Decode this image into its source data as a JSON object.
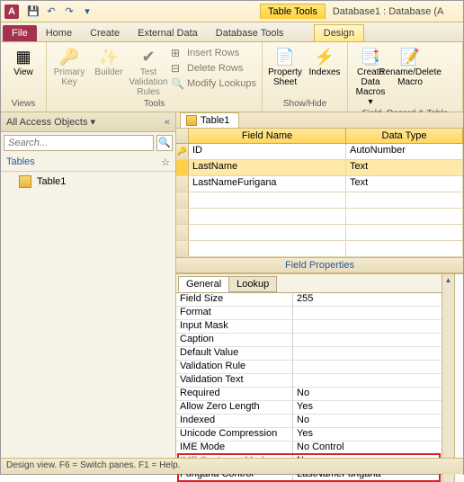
{
  "app_icon": "A",
  "qat": {
    "save": "💾",
    "undo": "↶",
    "redo": "↷",
    "more": "▾"
  },
  "context_tab_group": "Table Tools",
  "db_name": "Database1 : Database (A",
  "tabs": [
    "File",
    "Home",
    "Create",
    "External Data",
    "Database Tools",
    "Design"
  ],
  "ribbon": {
    "views": {
      "view": "View",
      "label": "Views"
    },
    "tools": {
      "pk": "Primary\nKey",
      "builder": "Builder",
      "tv": "Test Validation\nRules",
      "ins": "Insert Rows",
      "del": "Delete Rows",
      "mod": "Modify Lookups",
      "label": "Tools"
    },
    "showhide": {
      "ps": "Property\nSheet",
      "idx": "Indexes",
      "label": "Show/Hide"
    },
    "events": {
      "cdm": "Create Data\nMacros ▾",
      "rdm": "Rename/Delete\nMacro",
      "label": "Field, Record & Table Events"
    }
  },
  "nav": {
    "header": "All Access Objects",
    "collapse": "«",
    "dd": "▾",
    "search_placeholder": "Search...",
    "group": "Tables",
    "group_arrow": "☆",
    "items": [
      "Table1"
    ]
  },
  "doc_tab": "Table1",
  "grid": {
    "col_fn": "Field Name",
    "col_dt": "Data Type",
    "rows": [
      {
        "key": true,
        "fn": "ID",
        "dt": "AutoNumber"
      },
      {
        "key": false,
        "fn": "LastName",
        "dt": "Text",
        "sel": true
      },
      {
        "key": false,
        "fn": "LastNameFurigana",
        "dt": "Text"
      }
    ]
  },
  "fp_header": "Field Properties",
  "fp_tabs": [
    "General",
    "Lookup"
  ],
  "props": [
    {
      "n": "Field Size",
      "v": "255"
    },
    {
      "n": "Format",
      "v": ""
    },
    {
      "n": "Input Mask",
      "v": ""
    },
    {
      "n": "Caption",
      "v": ""
    },
    {
      "n": "Default Value",
      "v": ""
    },
    {
      "n": "Validation Rule",
      "v": ""
    },
    {
      "n": "Validation Text",
      "v": ""
    },
    {
      "n": "Required",
      "v": "No"
    },
    {
      "n": "Allow Zero Length",
      "v": "Yes"
    },
    {
      "n": "Indexed",
      "v": "No"
    },
    {
      "n": "Unicode Compression",
      "v": "Yes"
    },
    {
      "n": "IME Mode",
      "v": "No Control"
    },
    {
      "n": "IME Sentence Mode",
      "v": "None",
      "strike": true
    },
    {
      "n": "Furigana Control",
      "v": "LastNameFurigana"
    }
  ],
  "status": "Design view.  F6 = Switch panes.  F1 = Help."
}
